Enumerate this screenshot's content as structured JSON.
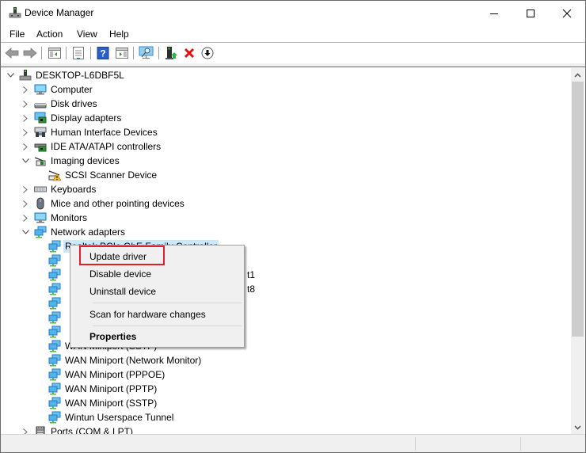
{
  "window": {
    "title": "Device Manager",
    "controls": {
      "minimize": "minimize",
      "maximize": "maximize",
      "close": "close"
    }
  },
  "menubar": {
    "items": [
      {
        "label": "File"
      },
      {
        "label": "Action"
      },
      {
        "label": "View"
      },
      {
        "label": "Help"
      }
    ]
  },
  "toolbar": {
    "buttons": [
      {
        "name": "back",
        "icon": "back-arrow-icon"
      },
      {
        "name": "forward",
        "icon": "forward-arrow-icon"
      },
      {
        "name": "show-hide-console-tree",
        "icon": "console-tree-icon"
      },
      {
        "name": "properties",
        "icon": "properties-sheet-icon"
      },
      {
        "name": "help",
        "icon": "help-icon"
      },
      {
        "name": "show-hide-action-pane",
        "icon": "action-pane-icon"
      },
      {
        "name": "scan-hardware",
        "icon": "scan-monitor-icon"
      },
      {
        "name": "update-driver",
        "icon": "update-driver-icon"
      },
      {
        "name": "uninstall-device",
        "icon": "red-x-icon"
      },
      {
        "name": "disable-device",
        "icon": "down-arrow-circle-icon"
      }
    ]
  },
  "tree": {
    "root": "DESKTOP-L6DBF5L",
    "items": [
      {
        "label": "Computer",
        "level": 1,
        "expander": "collapsed",
        "icon": "computer-icon"
      },
      {
        "label": "Disk drives",
        "level": 1,
        "expander": "collapsed",
        "icon": "disk-drive-icon"
      },
      {
        "label": "Display adapters",
        "level": 1,
        "expander": "collapsed",
        "icon": "display-adapter-icon"
      },
      {
        "label": "Human Interface Devices",
        "level": 1,
        "expander": "collapsed",
        "icon": "hid-icon"
      },
      {
        "label": "IDE ATA/ATAPI controllers",
        "level": 1,
        "expander": "collapsed",
        "icon": "ide-controller-icon"
      },
      {
        "label": "Imaging devices",
        "level": 1,
        "expander": "expanded",
        "icon": "imaging-device-icon"
      },
      {
        "label": "SCSI Scanner Device",
        "level": 2,
        "expander": "none",
        "icon": "scanner-warning-icon"
      },
      {
        "label": "Keyboards",
        "level": 1,
        "expander": "collapsed",
        "icon": "keyboard-icon"
      },
      {
        "label": "Mice and other pointing devices",
        "level": 1,
        "expander": "collapsed",
        "icon": "mouse-icon"
      },
      {
        "label": "Monitors",
        "level": 1,
        "expander": "collapsed",
        "icon": "monitor-icon"
      },
      {
        "label": "Network adapters",
        "level": 1,
        "expander": "expanded",
        "icon": "network-adapter-icon"
      },
      {
        "label": "Realtek PCIe GbE Family Controller",
        "level": 2,
        "expander": "none",
        "icon": "network-adapter-icon",
        "selected": true
      },
      {
        "label": "",
        "level": 2,
        "expander": "none",
        "icon": "network-adapter-icon"
      },
      {
        "label": "t1",
        "level": 2,
        "expander": "none",
        "icon": "network-adapter-icon",
        "partial": true
      },
      {
        "label": "t8",
        "level": 2,
        "expander": "none",
        "icon": "network-adapter-icon",
        "partial": true
      },
      {
        "label": "",
        "level": 2,
        "expander": "none",
        "icon": "network-adapter-icon"
      },
      {
        "label": "",
        "level": 2,
        "expander": "none",
        "icon": "network-adapter-icon"
      },
      {
        "label": "",
        "level": 2,
        "expander": "none",
        "icon": "network-adapter-icon"
      },
      {
        "label": "WAN Miniport (SSTP)",
        "level": 2,
        "expander": "none",
        "icon": "network-adapter-icon",
        "obscured": true
      },
      {
        "label": "WAN Miniport (Network Monitor)",
        "level": 2,
        "expander": "none",
        "icon": "network-adapter-icon"
      },
      {
        "label": "WAN Miniport (PPPOE)",
        "level": 2,
        "expander": "none",
        "icon": "network-adapter-icon"
      },
      {
        "label": "WAN Miniport (PPTP)",
        "level": 2,
        "expander": "none",
        "icon": "network-adapter-icon"
      },
      {
        "label": "WAN Miniport (SSTP)",
        "level": 2,
        "expander": "none",
        "icon": "network-adapter-icon"
      },
      {
        "label": "Wintun Userspace Tunnel",
        "level": 2,
        "expander": "none",
        "icon": "network-adapter-icon"
      },
      {
        "label": "Ports (COM & LPT)",
        "level": 1,
        "expander": "collapsed",
        "icon": "port-icon"
      }
    ]
  },
  "context_menu": {
    "items": [
      {
        "label": "Update driver",
        "highlighted": true
      },
      {
        "label": "Disable device"
      },
      {
        "label": "Uninstall device"
      },
      {
        "separator": true
      },
      {
        "label": "Scan for hardware changes"
      },
      {
        "separator": true
      },
      {
        "label": "Properties",
        "bold": true
      }
    ]
  },
  "colors": {
    "selection": "#cce8ff",
    "highlight_box": "#e0202a",
    "menu_bg": "#f0f0f0"
  }
}
